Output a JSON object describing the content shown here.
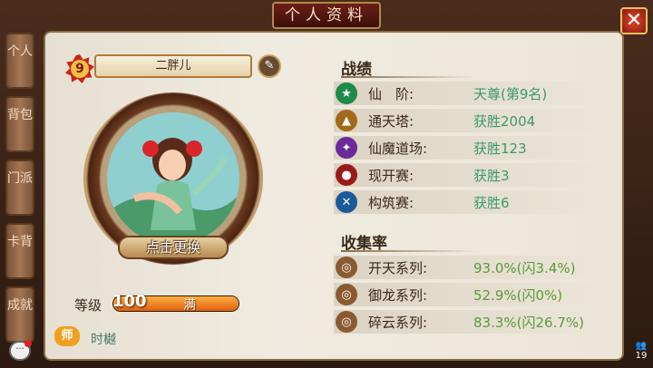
{
  "header": {
    "title": "个人资料",
    "close_label": "✕"
  },
  "tabs": [
    {
      "label": "个人",
      "active": true
    },
    {
      "label": "背包",
      "active": false
    },
    {
      "label": "门派",
      "active": false
    },
    {
      "label": "卡背",
      "active": false
    },
    {
      "label": "成就",
      "active": false
    }
  ],
  "profile": {
    "vip_level": "9",
    "name": "二胖儿",
    "change_label": "点击更换",
    "level_label": "等级",
    "level_value": "100",
    "level_max_label": "满",
    "level_progress": 1.0,
    "master_badge": "师",
    "master_name": "时樾"
  },
  "record": {
    "title": "战绩",
    "rows": [
      {
        "icon": "star-icon",
        "label": "仙　阶:",
        "value": "天尊(第9名)",
        "color": "#1f8a4a"
      },
      {
        "icon": "tower-icon",
        "label": "通天塔:",
        "value": "获胜2004",
        "color": "#a06a1a"
      },
      {
        "icon": "sword-icon",
        "label": "仙魔道场:",
        "value": "获胜123",
        "color": "#6a2a9a"
      },
      {
        "icon": "skull-icon",
        "label": "现开赛:",
        "value": "获胜3",
        "color": "#9a1a1a"
      },
      {
        "icon": "cross-swords-icon",
        "label": "构筑赛:",
        "value": "获胜6",
        "color": "#1a5a9a"
      }
    ]
  },
  "collection": {
    "title": "收集率",
    "rows": [
      {
        "icon": "scroll-icon-1",
        "label": "开天系列:",
        "value": "93.0%(闪3.4%)"
      },
      {
        "icon": "scroll-icon-2",
        "label": "御龙系列:",
        "value": "52.9%(闪0%)"
      },
      {
        "icon": "scroll-icon-3",
        "label": "碎云系列:",
        "value": "83.3%(闪26.7%)"
      }
    ]
  },
  "footer": {
    "online_count": "19"
  }
}
